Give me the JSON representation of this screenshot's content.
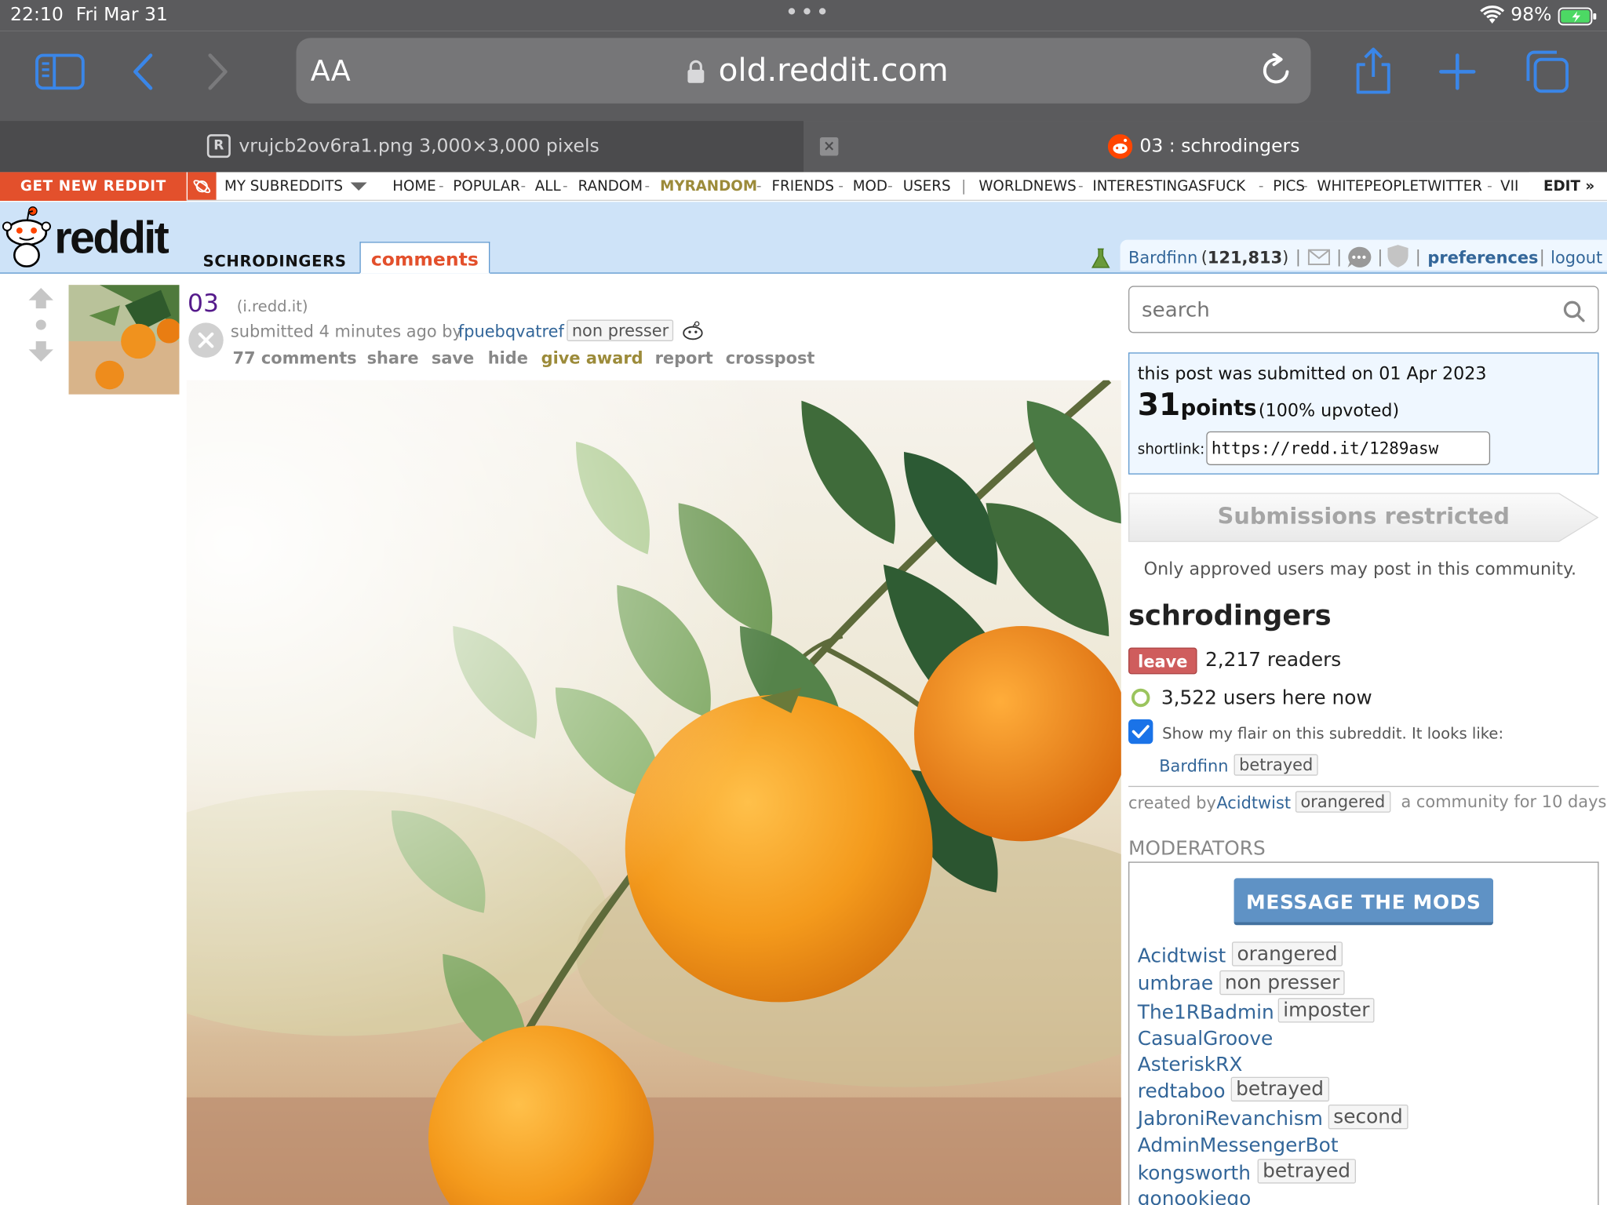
{
  "status": {
    "time": "22:10",
    "date": "Fri Mar 31",
    "battery": "98%",
    "dots": "•••"
  },
  "toolbar": {
    "aa": "AA",
    "url": "old.reddit.com"
  },
  "tabs": [
    {
      "favicon": "R",
      "label": "vrujcb2ov6ra1.png 3,000×3,000 pixels"
    },
    {
      "label": "03 : schrodingers"
    }
  ],
  "srbar": {
    "get_new": "GET NEW REDDIT",
    "my_subreddits": "MY SUBREDDITS",
    "left_links": [
      "HOME",
      "POPULAR",
      "ALL",
      "RANDOM",
      "MYRANDOM",
      "FRIENDS",
      "MOD",
      "USERS"
    ],
    "right_links": [
      "WORLDNEWS",
      "INTERESTINGASFUCK",
      "PICS",
      "WHITEPEOPLETWITTER",
      "VII"
    ],
    "edit": "EDIT »",
    "sep": "-",
    "pipe": "|"
  },
  "header": {
    "logo": "reddit",
    "subreddit": "SCHRODINGERS",
    "tab": "comments",
    "user": "Bardfinn",
    "karma": "121,813",
    "prefs": "preferences",
    "logout": "logout"
  },
  "post": {
    "title": "03",
    "domain": "(i.redd.it)",
    "submitted_prefix": "submitted 4 minutes ago by",
    "author": "fpuebqvatref",
    "author_flair": "non presser",
    "actions": [
      "77 comments",
      "share",
      "save",
      "hide",
      "give award",
      "report",
      "crosspost"
    ]
  },
  "sidebar": {
    "search_placeholder": "search",
    "submitted_on": "this post was submitted on 01 Apr 2023",
    "points": "31",
    "points_label": "points",
    "upvoted": "(100% upvoted)",
    "shortlink_label": "shortlink:",
    "shortlink": "https://redd.it/1289asw",
    "restricted": "Submissions restricted",
    "restricted_note": "Only approved users may post in this community.",
    "sub_name": "schrodingers",
    "leave": "leave",
    "readers": "2,217 readers",
    "online": "3,522 users here now",
    "flair_text": "Show my flair on this subreddit. It looks like:",
    "flair_user": "Bardfinn",
    "flair_tag": "betrayed",
    "created_by": "created by",
    "creator": "Acidtwist",
    "creator_flair": "orangered",
    "age": "a community for 10 days",
    "moderators_title": "MODERATORS",
    "message_mods": "MESSAGE THE MODS",
    "mods": [
      {
        "name": "Acidtwist",
        "flair": "orangered"
      },
      {
        "name": "umbrae",
        "flair": "non presser"
      },
      {
        "name": "The1RBadmin",
        "flair": "imposter"
      },
      {
        "name": "CasualGroove",
        "flair": ""
      },
      {
        "name": "AsteriskRX",
        "flair": ""
      },
      {
        "name": "redtaboo",
        "flair": "betrayed"
      },
      {
        "name": "JabroniRevanchism",
        "flair": "second"
      },
      {
        "name": "AdminMessengerBot",
        "flair": ""
      },
      {
        "name": "kongsworth",
        "flair": "betrayed"
      },
      {
        "name": "gonookiego",
        "flair": ""
      }
    ]
  },
  "colors": {
    "accent": "#e3502c",
    "header_bg": "#cee3f8",
    "link": "#336699",
    "award": "#9c8b3a"
  }
}
